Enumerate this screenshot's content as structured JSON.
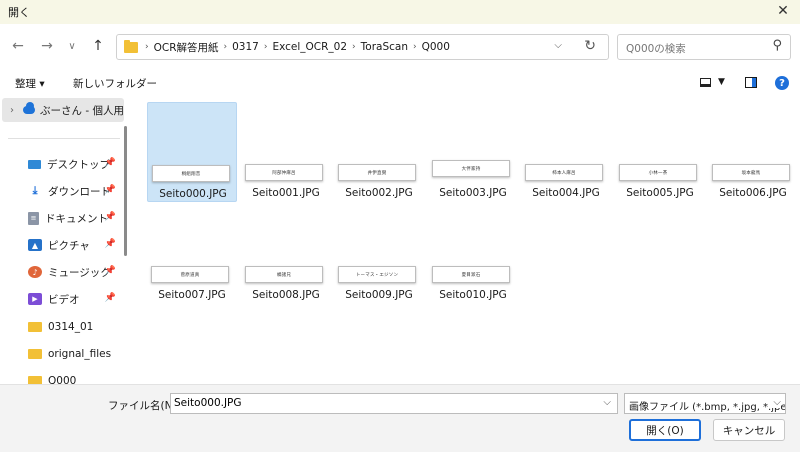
{
  "window": {
    "title": "開く"
  },
  "nav": {
    "back": "←",
    "forward": "→",
    "recent": "∨",
    "up": "↑"
  },
  "address": {
    "crumbs": [
      "OCR解答用紙",
      "0317",
      "Excel_OCR_02",
      "ToraScan",
      "Q000"
    ],
    "separator": "›"
  },
  "search": {
    "placeholder": "Q000の検索"
  },
  "toolbar": {
    "organize": "整理 ▾",
    "new_folder": "新しいフォルダー",
    "help": "?"
  },
  "sidebar": {
    "top": "ぶーさん - 個人用",
    "items": [
      {
        "label": "デスクトップ",
        "icon": "desktop-icon",
        "pinned": true
      },
      {
        "label": "ダウンロード",
        "icon": "download-icon",
        "pinned": true
      },
      {
        "label": "ドキュメント",
        "icon": "document-icon",
        "pinned": true
      },
      {
        "label": "ピクチャ",
        "icon": "pictures-icon",
        "pinned": true
      },
      {
        "label": "ミュージック",
        "icon": "music-icon",
        "pinned": true
      },
      {
        "label": "ビデオ",
        "icon": "video-icon",
        "pinned": true
      },
      {
        "label": "0314_01",
        "icon": "folder-icon",
        "pinned": false
      },
      {
        "label": "orignal_files",
        "icon": "folder-icon",
        "pinned": false
      },
      {
        "label": "Q000",
        "icon": "folder-icon",
        "pinned": false
      }
    ]
  },
  "files": [
    {
      "name": "Seito000.JPG",
      "thumb_text": "桐組翔音",
      "selected": true
    },
    {
      "name": "Seito001.JPG",
      "thumb_text": "阿部仲麻呂"
    },
    {
      "name": "Seito002.JPG",
      "thumb_text": "井伊直弼"
    },
    {
      "name": "Seito003.JPG",
      "thumb_text": "大伴家持"
    },
    {
      "name": "Seito004.JPG",
      "thumb_text": "柿本人麻呂"
    },
    {
      "name": "Seito005.JPG",
      "thumb_text": "小林一茶"
    },
    {
      "name": "Seito006.JPG",
      "thumb_text": "坂本龍馬"
    },
    {
      "name": "Seito007.JPG",
      "thumb_text": "菅原道真"
    },
    {
      "name": "Seito008.JPG",
      "thumb_text": "橘諸兄"
    },
    {
      "name": "Seito009.JPG",
      "thumb_text": "トーマス・エジソン"
    },
    {
      "name": "Seito010.JPG",
      "thumb_text": "夏目漱石"
    }
  ],
  "footer": {
    "filename_label": "ファイル名(N):",
    "filename_value": "Seito000.JPG",
    "filter_value": "画像ファイル (*.bmp, *.jpg, *.jpeg",
    "open_label": "開く(O)",
    "cancel_label": "キャンセル"
  },
  "colors": {
    "accent": "#1e6fd9",
    "selection": "#cce4f7",
    "folder": "#f2c036"
  }
}
